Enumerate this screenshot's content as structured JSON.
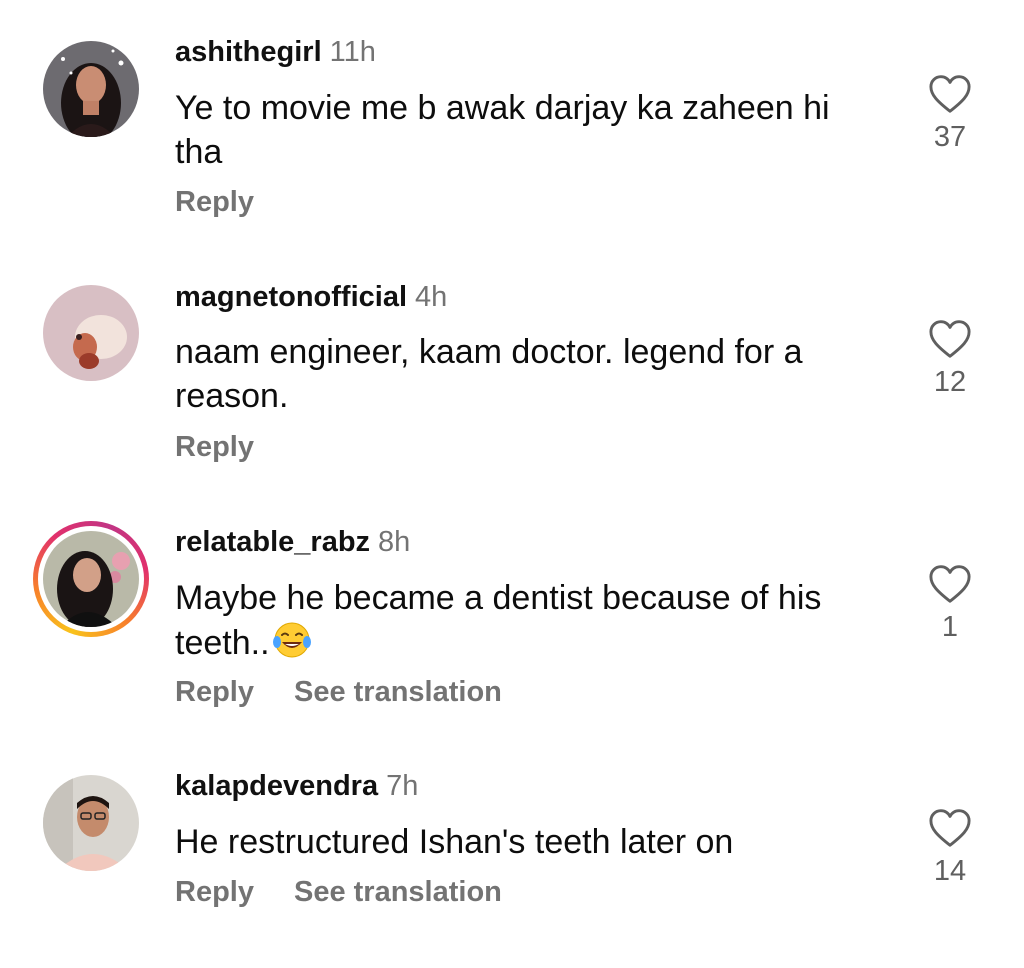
{
  "comments": [
    {
      "username": "ashithegirl",
      "time": "11h",
      "text": "Ye to movie me b awak darjay ka zaheen hi tha",
      "reply_label": "Reply",
      "likes": "37"
    },
    {
      "username": "magnetonofficial",
      "time": "4h",
      "text": "naam engineer, kaam doctor. legend for a reason.",
      "reply_label": "Reply",
      "likes": "12"
    },
    {
      "username": "relatable_rabz",
      "time": "8h",
      "text": "Maybe he became a dentist because of his teeth..",
      "reply_label": "Reply",
      "translation_label": "See translation",
      "likes": "1"
    },
    {
      "username": "kalapdevendra",
      "time": "7h",
      "text": "He restructured Ishan's teeth later on",
      "reply_label": "Reply",
      "translation_label": "See translation",
      "likes": "14"
    }
  ],
  "icons": {
    "like": "heart-outline-icon",
    "emoji": "face-with-tears-of-joy-icon"
  },
  "colors": {
    "text": "#0d0d0d",
    "secondary": "#737373",
    "story_ring_start": "#f9c31c",
    "story_ring_end": "#c13584"
  }
}
